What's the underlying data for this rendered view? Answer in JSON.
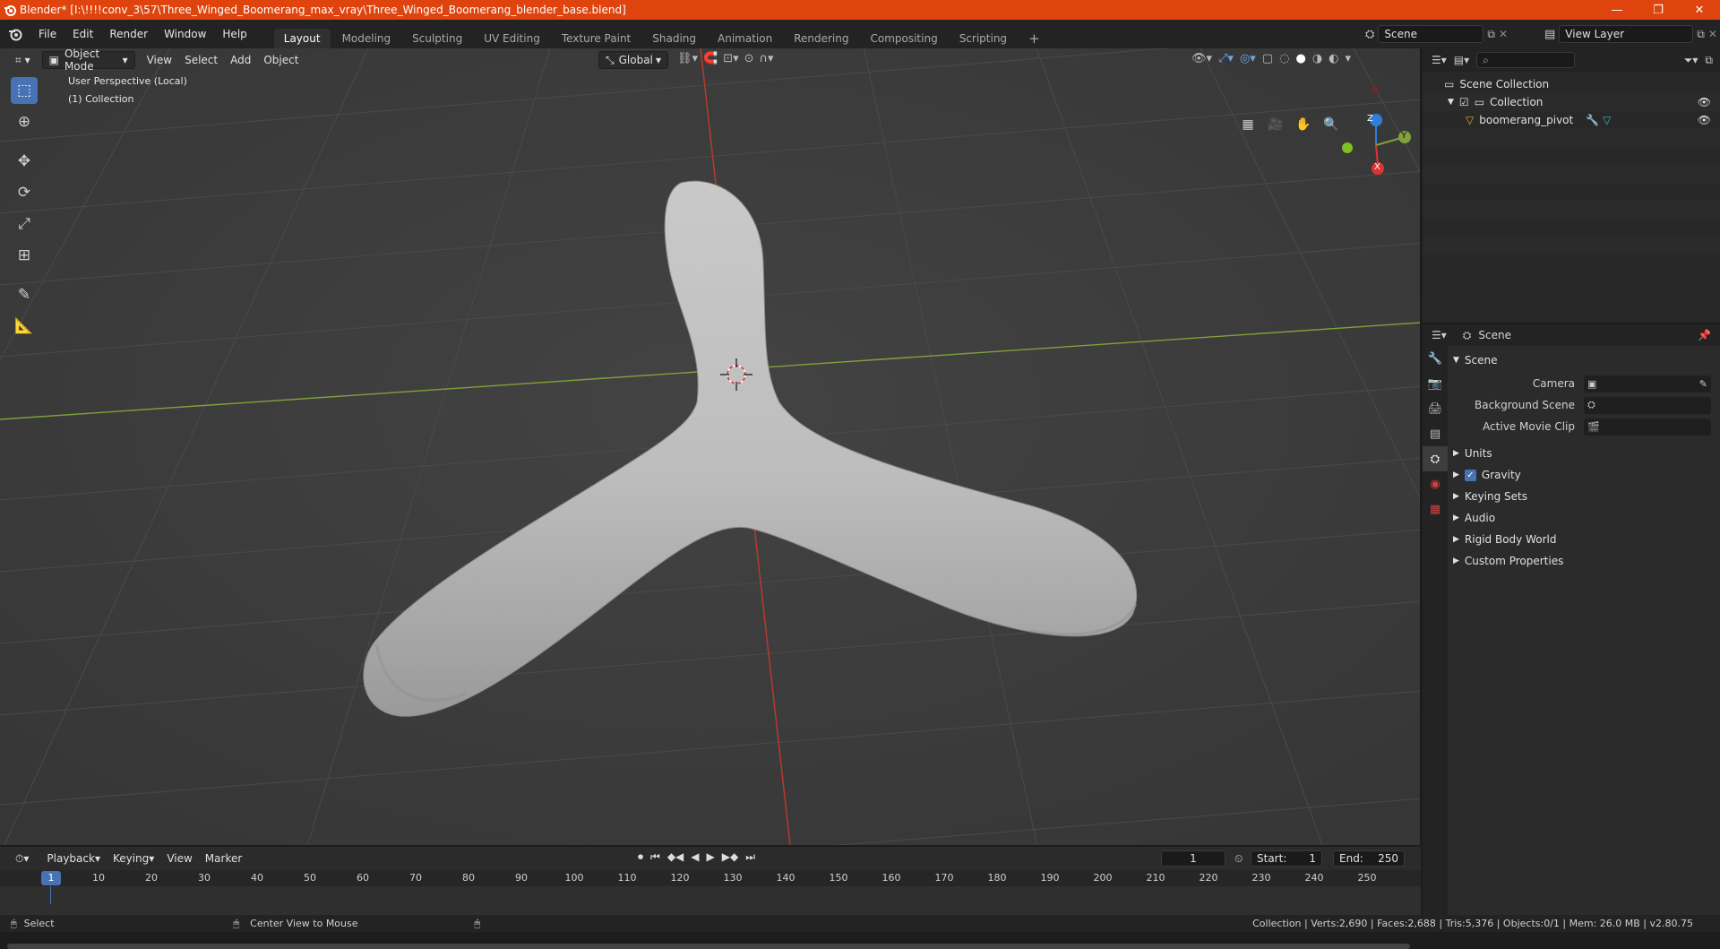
{
  "window": {
    "title": "Blender* [I:\\!!!!conv_3\\57\\Three_Winged_Boomerang_max_vray\\Three_Winged_Boomerang_blender_base.blend]",
    "minimize": "—",
    "restore": "❐",
    "close": "✕"
  },
  "menu": {
    "file": "File",
    "edit": "Edit",
    "render": "Render",
    "window": "Window",
    "help": "Help"
  },
  "workspaces": [
    "Layout",
    "Modeling",
    "Sculpting",
    "UV Editing",
    "Texture Paint",
    "Shading",
    "Animation",
    "Rendering",
    "Compositing",
    "Scripting"
  ],
  "workspace_add": "+",
  "scene_selector": {
    "value": "Scene"
  },
  "view_layer_selector": {
    "value": "View Layer"
  },
  "viewport": {
    "mode": "Object Mode",
    "view": "View",
    "select": "Select",
    "add": "Add",
    "object": "Object",
    "orientation": "Global",
    "perspective_label": "User Perspective (Local)",
    "collection_label": "(1) Collection",
    "gizmo": {
      "z": "Z",
      "y": "Y",
      "x": "X"
    }
  },
  "outliner": {
    "search_placeholder": "",
    "rows": [
      {
        "label": "Scene Collection"
      },
      {
        "label": "Collection"
      },
      {
        "label": "boomerang_pivot"
      }
    ]
  },
  "properties": {
    "header": "Scene",
    "panel_scene": "Scene",
    "camera_label": "Camera",
    "camera_value": "",
    "bg_scene_label": "Background Scene",
    "bg_scene_value": "",
    "movie_clip_label": "Active Movie Clip",
    "movie_clip_value": "",
    "units": "Units",
    "gravity": "Gravity",
    "gravity_checked": true,
    "keying_sets": "Keying Sets",
    "audio": "Audio",
    "rigid_body": "Rigid Body World",
    "custom_props": "Custom Properties"
  },
  "timeline": {
    "playback": "Playback",
    "keying": "Keying",
    "view": "View",
    "marker": "Marker",
    "current_frame": "1",
    "start_label": "Start:",
    "start_value": "1",
    "end_label": "End:",
    "end_value": "250",
    "ticks": [
      "10",
      "20",
      "30",
      "40",
      "50",
      "60",
      "70",
      "80",
      "90",
      "100",
      "110",
      "120",
      "130",
      "140",
      "150",
      "160",
      "170",
      "180",
      "190",
      "200",
      "210",
      "220",
      "230",
      "240",
      "250"
    ]
  },
  "status": {
    "select": "Select",
    "center_view": "Center View to Mouse",
    "stats": "Collection | Verts:2,690 | Faces:2,688 | Tris:5,376 | Objects:0/1 | Mem: 26.0 MB | v2.80.75"
  },
  "colors": {
    "titlebar": "#e0440e",
    "accent": "#4772b3",
    "viewport_bg": "#3d3d3d",
    "x_axis": "#c0392b",
    "y_axis": "#7fa23a"
  }
}
